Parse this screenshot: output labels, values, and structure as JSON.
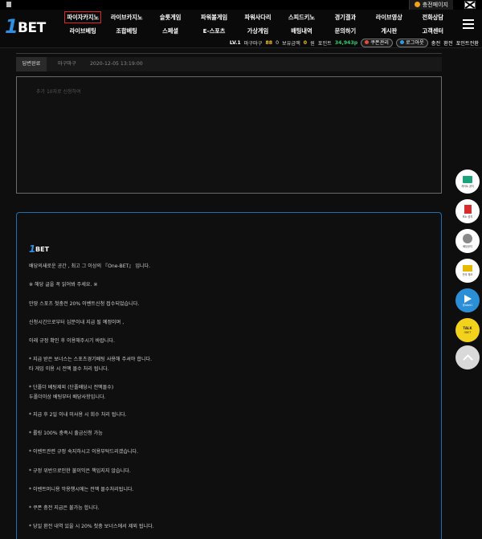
{
  "topbar": {
    "home_label": "충전페이지"
  },
  "logo": {
    "one": "1",
    "bet": "BET"
  },
  "nav": {
    "row1": [
      "파이자카지노",
      "라이브카지노",
      "슬롯게임",
      "파워볼게임",
      "파워사다리",
      "스피드키노",
      "경기결과",
      "라이브영상",
      "전화상담"
    ],
    "row2": [
      "라이브베팅",
      "조합베팅",
      "스페셜",
      "E-스포츠",
      "가상게임",
      "배팅내역",
      "문의하기",
      "게시판",
      "고객센터"
    ]
  },
  "user": {
    "level": "LV.1",
    "name": "마구마구",
    "count": "88",
    "count_unit": "0",
    "balance_label": "보유금액",
    "balance": "0",
    "balance_unit": "원",
    "point_label": "포인트",
    "point": "34,943p",
    "coupon_btn": "쿠폰관리",
    "logout_btn": "로그아웃",
    "charge": "충전",
    "exchange": "환전",
    "point_exchange": "포인트전환"
  },
  "post": {
    "status": "답변완료",
    "author": "마구마구",
    "date": "2020-12-05 13:19:00",
    "comment_placeholder": "추가 10자로 신청하여"
  },
  "notice": {
    "lines": [
      "배당의새로운 공간 , 최고 그 이상의 『One-BET』 입니다.",
      "※ 해당 글을 꼭 읽어봐 주세요. ※",
      "만땅 스포츠 첫충전 20% 이벤트신청 접수되었습니다.",
      "신청시간으로부터 십분이내 지급 될 예정이며 ,",
      "아래 규정 확인 후 이용해주시기 바랍니다.",
      "* 지급 받은 보너스는 스포츠경기배팅 사용해 주셔야 합니다.",
      "   타 게임 이용 시 전액 몰수 처리 됩니다.",
      "* 단폴더 베팅제외 (단폴배당시 전액몰수)",
      "   두폴더이상 베팅부터 배당사항입니다.",
      "* 지급 후 2일 이내 미사용 시 회수 처리 됩니다.",
      "* 롤링 100% 충족시 출금신청 가능",
      "* 이벤트관련 규정 숙지하시고 이용부탁드리겠습니다.",
      "* 규정 위반으로인한 불이익은 책임지지 않습니다.",
      "* 이벤트머니용 악용행시에는 전액 몰수처리됩니다.",
      "* 쿠폰 충전 지급은 불가능 합니다.",
      "* 당일 환전 내역 있을 시 20% 첫충 보너스에서 제외 됩니다."
    ]
  },
  "floats": [
    {
      "label": "게이트 공지"
    },
    {
      "label": "모노 공지"
    },
    {
      "label": "배당공지"
    },
    {
      "label": "전국 체크"
    },
    {
      "label": "@obet1"
    },
    {
      "label": "OBET",
      "talk": "TALK"
    }
  ]
}
